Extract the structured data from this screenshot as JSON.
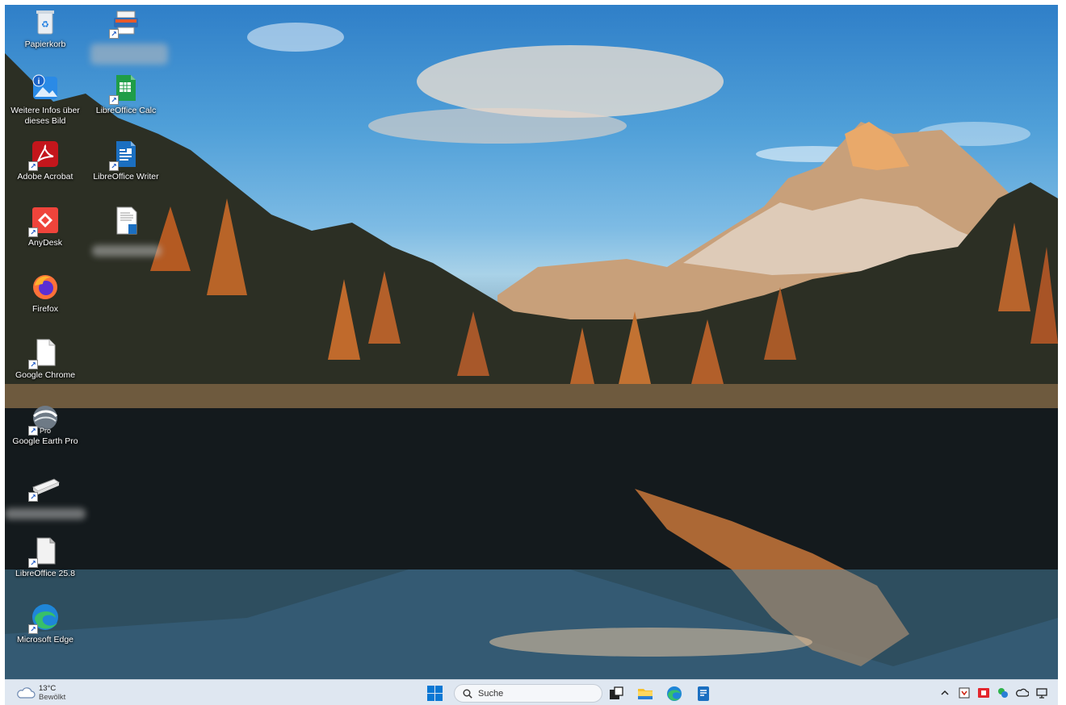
{
  "desktop_icons": [
    {
      "id": "recycle",
      "label": "Papierkorb"
    },
    {
      "id": "printer-app",
      "label": ""
    },
    {
      "id": "weitere-infos",
      "label": "Weitere Infos über dieses Bild"
    },
    {
      "id": "libreoffice-calc",
      "label": "LibreOffice Calc"
    },
    {
      "id": "adobe-acrobat",
      "label": "Adobe Acrobat"
    },
    {
      "id": "libreoffice-writer",
      "label": "LibreOffice Writer"
    },
    {
      "id": "anydesk",
      "label": "AnyDesk"
    },
    {
      "id": "document-file",
      "label": ""
    },
    {
      "id": "firefox",
      "label": "Firefox"
    },
    {
      "id": "google-chrome",
      "label": "Google Chrome"
    },
    {
      "id": "google-earth-pro",
      "label": "Google Earth Pro",
      "badge": "Pro"
    },
    {
      "id": "scanner-app",
      "label": ""
    },
    {
      "id": "libreoffice",
      "label": "LibreOffice 25.8"
    },
    {
      "id": "microsoft-edge",
      "label": "Microsoft Edge"
    }
  ],
  "taskbar": {
    "weather": {
      "temperature": "13°C",
      "condition": "Bewölkt"
    },
    "search": {
      "placeholder": "Suche"
    },
    "apps": [
      "task-view-icon",
      "file-explorer-icon",
      "edge-icon",
      "office-app-icon"
    ],
    "tray": [
      "chevron-up-icon",
      "tray-app-icon",
      "red-tray-icon",
      "security-icon",
      "cloud-icon",
      "network-icon"
    ]
  },
  "colors": {
    "taskbar_bg": "#dfe7f1",
    "windows_blue": "#0a78d4",
    "acrobat_red": "#c4161c",
    "anydesk_red": "#ef443b",
    "calc_green": "#1f9d48",
    "writer_blue": "#1b6fc1"
  }
}
